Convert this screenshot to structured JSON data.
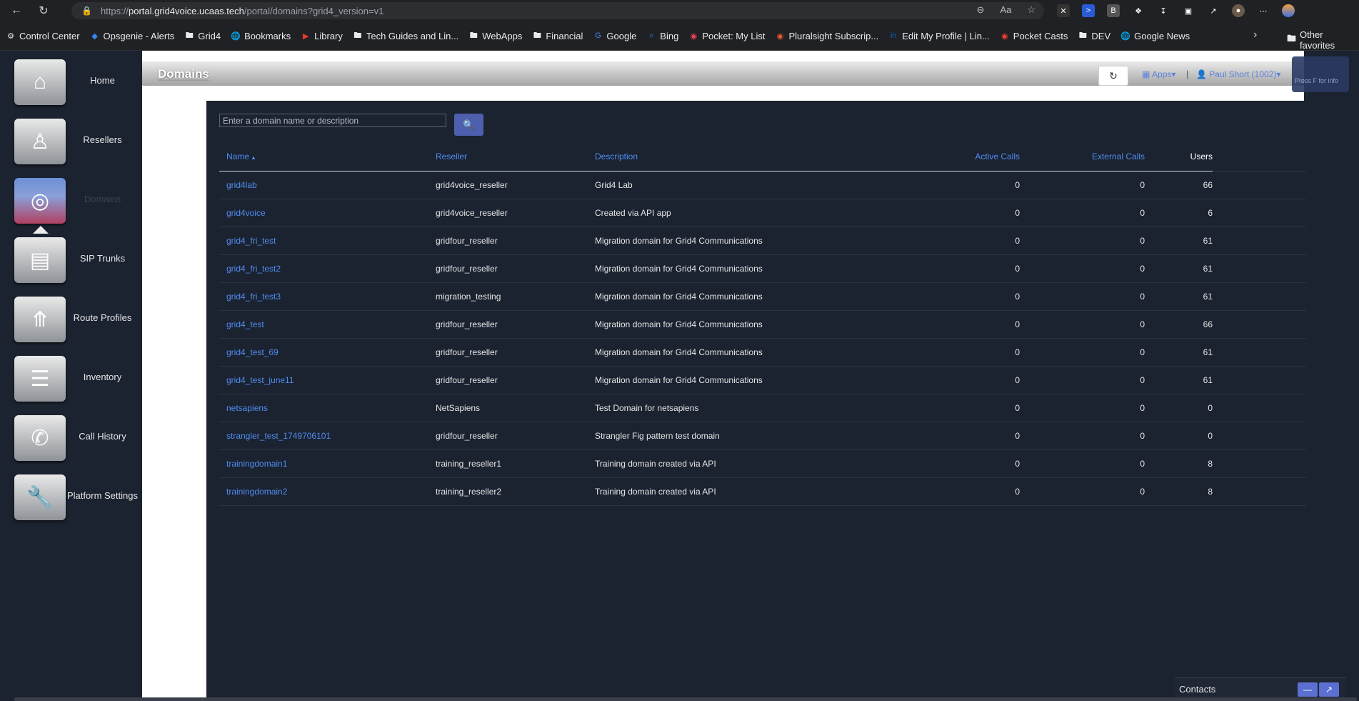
{
  "browser": {
    "url_prefix": "https://",
    "url_host": "portal.grid4voice.ucaas.tech",
    "url_path": "/portal/domains?grid4_version=v1",
    "bookmarks": [
      {
        "label": "Control Center",
        "icon": "gear-icon"
      },
      {
        "label": "Opsgenie - Alerts",
        "icon": "opsgenie-icon"
      },
      {
        "label": "Grid4",
        "icon": "folder-icon"
      },
      {
        "label": "Bookmarks",
        "icon": "globe-icon"
      },
      {
        "label": "Library",
        "icon": "youtube-icon"
      },
      {
        "label": "Tech Guides and Lin...",
        "icon": "folder-icon"
      },
      {
        "label": "WebApps",
        "icon": "folder-icon"
      },
      {
        "label": "Financial",
        "icon": "folder-icon"
      },
      {
        "label": "Google",
        "icon": "google-icon"
      },
      {
        "label": "Bing",
        "icon": "search-icon"
      },
      {
        "label": "Pocket: My List",
        "icon": "pocket-icon"
      },
      {
        "label": "Pluralsight Subscrip...",
        "icon": "pluralsight-icon"
      },
      {
        "label": "Edit My Profile | Lin...",
        "icon": "linkedin-icon"
      },
      {
        "label": "Pocket Casts",
        "icon": "pocketcasts-icon"
      },
      {
        "label": "DEV",
        "icon": "folder-icon"
      },
      {
        "label": "Google News",
        "icon": "globe-icon"
      }
    ],
    "other_favorites": "Other favorites"
  },
  "nav": {
    "items": [
      {
        "label": "Home",
        "icon": "home-icon",
        "active": false
      },
      {
        "label": "Resellers",
        "icon": "reseller-icon",
        "active": false
      },
      {
        "label": "Domains",
        "icon": "domains-icon",
        "active": true
      },
      {
        "label": "SIP Trunks",
        "icon": "sip-trunks-icon",
        "active": false
      },
      {
        "label": "Route Profiles",
        "icon": "route-profiles-icon",
        "active": false
      },
      {
        "label": "Inventory",
        "icon": "inventory-icon",
        "active": false
      },
      {
        "label": "Call History",
        "icon": "call-history-icon",
        "active": false
      },
      {
        "label": "Platform Settings",
        "icon": "wrench-icon",
        "active": false
      }
    ]
  },
  "header": {
    "title": "Domains",
    "apps_label": "Apps",
    "separator": "|",
    "user_label": "Paul Short (1002)",
    "info_hint": "Press F for info"
  },
  "search": {
    "placeholder": "Enter a domain name or description"
  },
  "table": {
    "columns": [
      "Name",
      "Reseller",
      "Description",
      "Active Calls",
      "External Calls",
      "Users"
    ],
    "rows": [
      {
        "name": "grid4lab",
        "reseller": "grid4voice_reseller",
        "description": "Grid4 Lab",
        "active_calls": "0",
        "external_calls": "0",
        "users": "66"
      },
      {
        "name": "grid4voice",
        "reseller": "grid4voice_reseller",
        "description": "Created via API app",
        "active_calls": "0",
        "external_calls": "0",
        "users": "6"
      },
      {
        "name": "grid4_fri_test",
        "reseller": "gridfour_reseller",
        "description": "Migration domain for Grid4 Communications",
        "active_calls": "0",
        "external_calls": "0",
        "users": "61"
      },
      {
        "name": "grid4_fri_test2",
        "reseller": "gridfour_reseller",
        "description": "Migration domain for Grid4 Communications",
        "active_calls": "0",
        "external_calls": "0",
        "users": "61"
      },
      {
        "name": "grid4_fri_test3",
        "reseller": "migration_testing",
        "description": "Migration domain for Grid4 Communications",
        "active_calls": "0",
        "external_calls": "0",
        "users": "61"
      },
      {
        "name": "grid4_test",
        "reseller": "gridfour_reseller",
        "description": "Migration domain for Grid4 Communications",
        "active_calls": "0",
        "external_calls": "0",
        "users": "66"
      },
      {
        "name": "grid4_test_69",
        "reseller": "gridfour_reseller",
        "description": "Migration domain for Grid4 Communications",
        "active_calls": "0",
        "external_calls": "0",
        "users": "61"
      },
      {
        "name": "grid4_test_june11",
        "reseller": "gridfour_reseller",
        "description": "Migration domain for Grid4 Communications",
        "active_calls": "0",
        "external_calls": "0",
        "users": "61"
      },
      {
        "name": "netsapiens",
        "reseller": "NetSapiens",
        "description": "Test Domain for netsapiens",
        "active_calls": "0",
        "external_calls": "0",
        "users": "0"
      },
      {
        "name": "strangler_test_1749706101",
        "reseller": "gridfour_reseller",
        "description": "Strangler Fig pattern test domain",
        "active_calls": "0",
        "external_calls": "0",
        "users": "0"
      },
      {
        "name": "trainingdomain1",
        "reseller": "training_reseller1",
        "description": "Training domain created via API",
        "active_calls": "0",
        "external_calls": "0",
        "users": "8"
      },
      {
        "name": "trainingdomain2",
        "reseller": "training_reseller2",
        "description": "Training domain created via API",
        "active_calls": "0",
        "external_calls": "0",
        "users": "8"
      }
    ]
  },
  "contacts": {
    "label": "Contacts"
  },
  "colors": {
    "accent": "#4f8ef0",
    "background": "#1b2230",
    "search_button": "#4e5fae"
  }
}
